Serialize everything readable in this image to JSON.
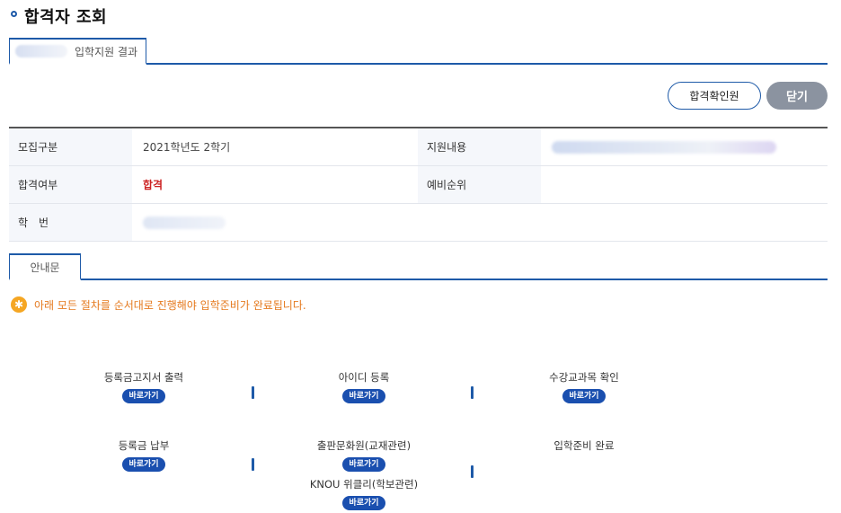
{
  "page": {
    "title": "합격자 조회"
  },
  "tabs": {
    "result_tab": "입학지원 결과",
    "guide_tab": "안내문"
  },
  "buttons": {
    "pass_cert": "합격확인원",
    "close": "닫기"
  },
  "info": {
    "labels": {
      "recruit_type": "모집구분",
      "apply_content": "지원내용",
      "pass_status": "합격여부",
      "waitlist_rank": "예비순위",
      "student_id": "학　번"
    },
    "values": {
      "recruit_type": "2021학년도 2학기",
      "pass_status": "합격"
    }
  },
  "notice": {
    "icon": "asterisk-icon",
    "text": "아래 모든 절차를 순서대로 진행해야 입학준비가 완료됩니다."
  },
  "steps": {
    "go_label": "바로가기",
    "tuition_notice_print": "등록금고지서 출력",
    "id_register": "아이디 등록",
    "course_check": "수강교과목 확인",
    "tuition_payment": "등록금 납부",
    "publishing_member": "출판문화원(교재관련)",
    "knou_weekly": "KNOU 위클리(학보관련)",
    "prep_complete": "입학준비 완료"
  },
  "colors": {
    "accent": "#1e5aa8",
    "pass": "#cc2222",
    "notice": "#e57a1f",
    "go_button": "#1a4faf",
    "close_button": "#8b93a0"
  }
}
